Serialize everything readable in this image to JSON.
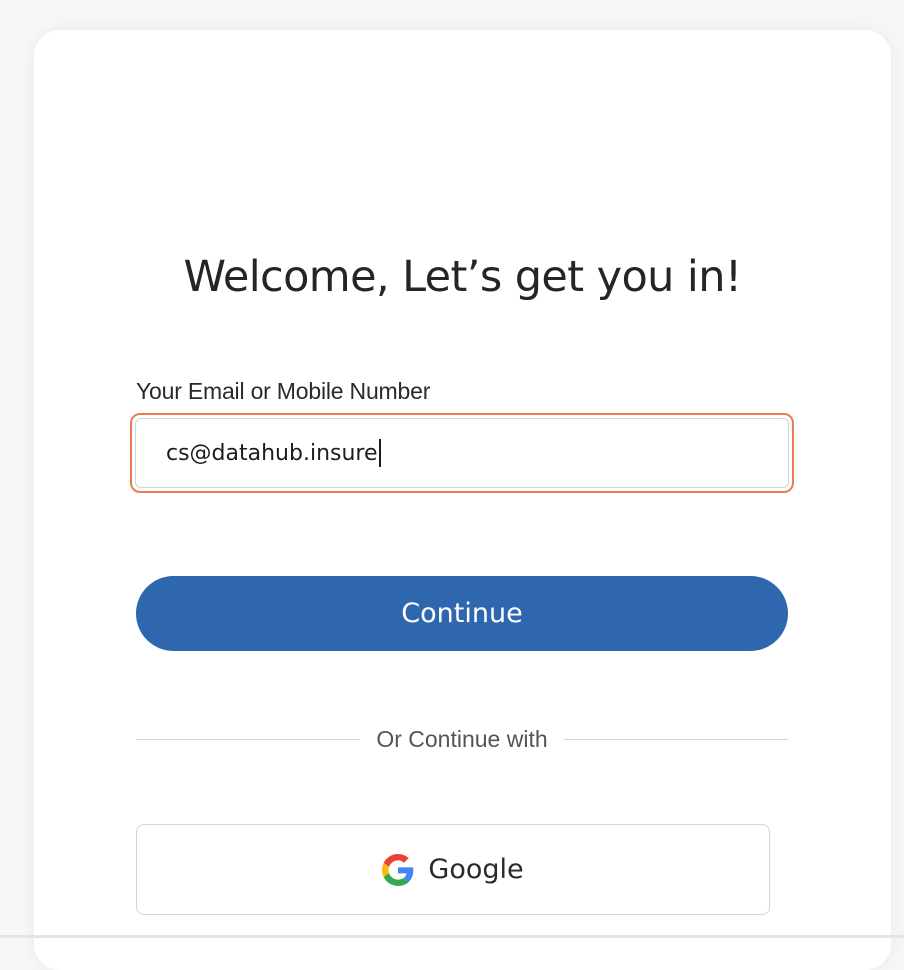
{
  "login": {
    "heading": "Welcome, Let’s get you in!",
    "field_label": "Your Email or Mobile Number",
    "email_value": "cs@datahub.insure",
    "continue_label": "Continue",
    "divider_text": "Or Continue with",
    "google_label": "Google",
    "google_icon": "google-g-icon"
  },
  "colors": {
    "primary": "#2f67ae",
    "focus_ring": "#ee7b4f",
    "card_background": "#ffffff",
    "page_background": "#f7f7f8"
  }
}
